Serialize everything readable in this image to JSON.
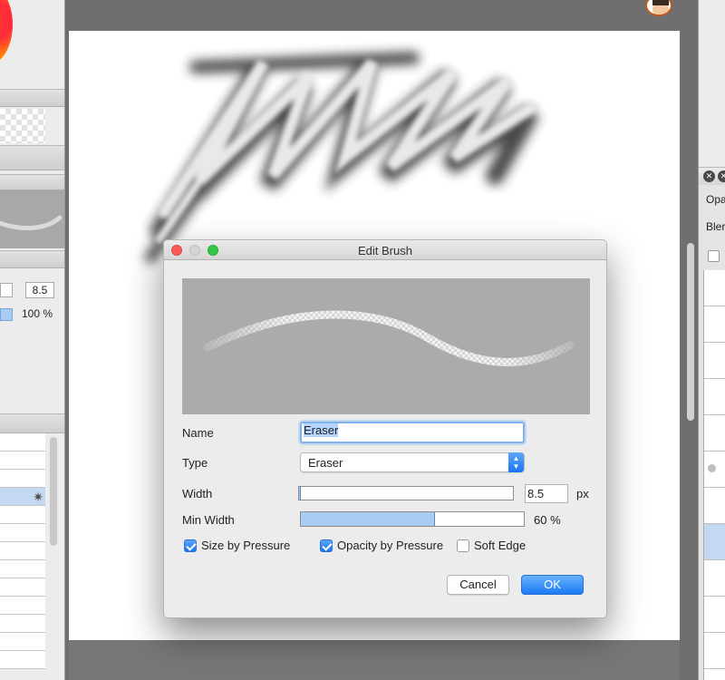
{
  "left_panel": {
    "width_value": "8.5",
    "min_width_value": "100 %",
    "brush_list_rows": 13,
    "selected_row": 3
  },
  "dialog": {
    "title": "Edit Brush",
    "name_label": "Name",
    "name_value": "Eraser",
    "type_label": "Type",
    "type_value": "Eraser",
    "width_label": "Width",
    "width_value": "8.5",
    "width_unit": "px",
    "width_fraction": 0.01,
    "min_width_label": "Min Width",
    "min_width_value": "60 %",
    "min_width_fraction": 0.6,
    "size_by_pressure_label": "Size by Pressure",
    "size_by_pressure_checked": true,
    "opacity_by_pressure_label": "Opacity by Pressure",
    "opacity_by_pressure_checked": true,
    "soft_edge_label": "Soft Edge",
    "soft_edge_checked": false,
    "cancel_label": "Cancel",
    "ok_label": "OK"
  },
  "right_panel": {
    "opacity_label_partial": "Opa",
    "blend_label_partial": "Bler"
  },
  "colors": {
    "accent": "#1a7bf5",
    "selection": "#c3d9f1",
    "slider_fill": "#a9cdf2",
    "dialog_bg": "#ececec",
    "preview_bg": "#ababab",
    "workspace_bg": "#6f6f6f"
  },
  "icons": [
    "close-dot-icon",
    "minimize-dot-icon",
    "maximize-dot-icon",
    "gear-icon",
    "checkmark-icon",
    "select-arrows-icon",
    "avatar-icon",
    "panel-close-icon"
  ]
}
